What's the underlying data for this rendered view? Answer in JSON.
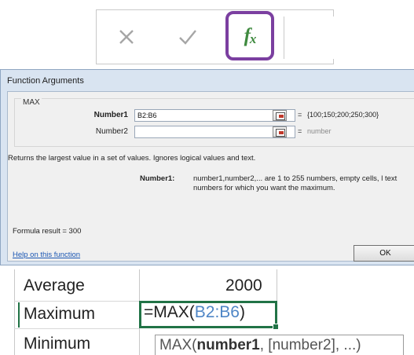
{
  "formula_bar": {
    "icons": [
      "cancel-x-icon",
      "enter-check-icon",
      "insert-function-icon"
    ],
    "fx_label_f": "f",
    "fx_label_x": "x",
    "highlight_color": "#7b3fa0"
  },
  "dialog": {
    "title": "Function Arguments",
    "function_name": "MAX",
    "args": [
      {
        "label": "Number1",
        "value": "B2:B6",
        "result": "{100;150;200;250;300}"
      },
      {
        "label": "Number2",
        "value": "",
        "result": "number"
      }
    ],
    "equals": "=",
    "description": "Returns the largest value in a set of values. Ignores logical values and text.",
    "arg_help_label": "Number1:",
    "arg_help_text": "number1,number2,... are 1 to 255 numbers, empty cells, l text numbers for which you want the maximum.",
    "formula_result_label": "Formula result =",
    "formula_result_value": "300",
    "help_link": "Help on this function",
    "ok_label": "OK"
  },
  "sheet": {
    "rows": [
      {
        "label": "Average",
        "value": "2000"
      },
      {
        "label": "Maximum",
        "value": ""
      },
      {
        "label": "Minimum",
        "value": ""
      }
    ],
    "edit_prefix": "=MAX(",
    "edit_ref": "B2:B6",
    "edit_suffix": ")",
    "tooltip_func": "MAX(",
    "tooltip_arg1": "number1",
    "tooltip_rest": ", [number2], ...)",
    "active_border_color": "#217346",
    "ref_color": "#4f86c6"
  }
}
